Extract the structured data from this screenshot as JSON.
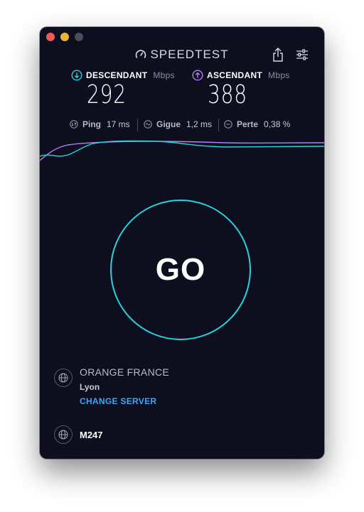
{
  "app": {
    "title": "SPEEDTEST"
  },
  "toolbar": {
    "share_icon": "share-icon",
    "settings_icon": "sliders-icon"
  },
  "download": {
    "label": "DESCENDANT",
    "unit": "Mbps",
    "value": "292",
    "color": "#2ad3dc",
    "icon": "arrow-down-circle-icon"
  },
  "upload": {
    "label": "ASCENDANT",
    "unit": "Mbps",
    "value": "388",
    "color": "#b57ef6",
    "icon": "arrow-up-circle-icon"
  },
  "stats": {
    "ping": {
      "label": "Ping",
      "value": "17 ms"
    },
    "jitter": {
      "label": "Gigue",
      "value": "1,2 ms"
    },
    "loss": {
      "label": "Perte",
      "value": "0,38 %"
    }
  },
  "go_button": {
    "label": "GO",
    "ring_color": "#2ad3dc"
  },
  "server": {
    "isp": "ORANGE FRANCE",
    "city": "Lyon",
    "change_label": "CHANGE SERVER",
    "icon": "globe-icon"
  },
  "connection": {
    "name": "M247",
    "icon": "globe-icon"
  },
  "colors": {
    "background": "#0d0f1e",
    "accent_link": "#3aa8f5"
  }
}
